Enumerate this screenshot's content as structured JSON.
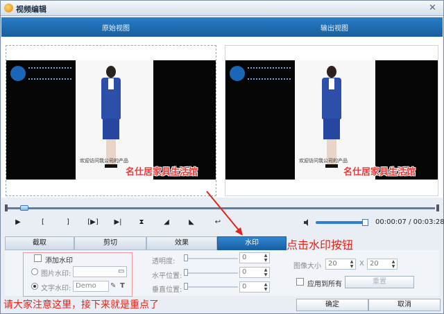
{
  "window": {
    "title": "视频编辑",
    "close_glyph": "✕"
  },
  "views": {
    "original_label": "原始视图",
    "output_label": "输出视图"
  },
  "video": {
    "caption": "欢迎访问我公司的产品",
    "watermark_text": "名仕居家具生活馆"
  },
  "playback": {
    "current_time": "00:00:07",
    "total_time": "00:03:28",
    "time_separator": " / ",
    "controls": [
      "▶",
      "[",
      "]",
      "[▶]",
      "▶|",
      "⧗",
      "◢",
      "◣",
      "↩"
    ]
  },
  "tabs": [
    {
      "label": "截取",
      "active": false
    },
    {
      "label": "剪切",
      "active": false
    },
    {
      "label": "效果",
      "active": false
    },
    {
      "label": "水印",
      "active": true
    }
  ],
  "annotations": {
    "tab_callout": "点击水印按钮",
    "bottom_callout": "请大家注意这里，接下来就是重点了"
  },
  "watermark": {
    "add_label": "添加水印",
    "add_checked": false,
    "image_label": "图片水印:",
    "image_value": "",
    "text_label": "文字水印:",
    "text_value": "Demo",
    "text_selected": true
  },
  "adjust": {
    "opacity_label": "透明度:",
    "opacity_value": "0",
    "hpos_label": "水平位置:",
    "hpos_value": "0",
    "vpos_label": "垂直位置:",
    "vpos_value": "0"
  },
  "image_size": {
    "label": "图像大小",
    "width": "20",
    "separator": "X",
    "height": "20"
  },
  "apply_all_label": "应用到所有",
  "reset_label": "重置",
  "ok_label": "确定",
  "cancel_label": "取消",
  "colors": {
    "accent": "#1d6aaf",
    "annotation": "#e2231a"
  }
}
